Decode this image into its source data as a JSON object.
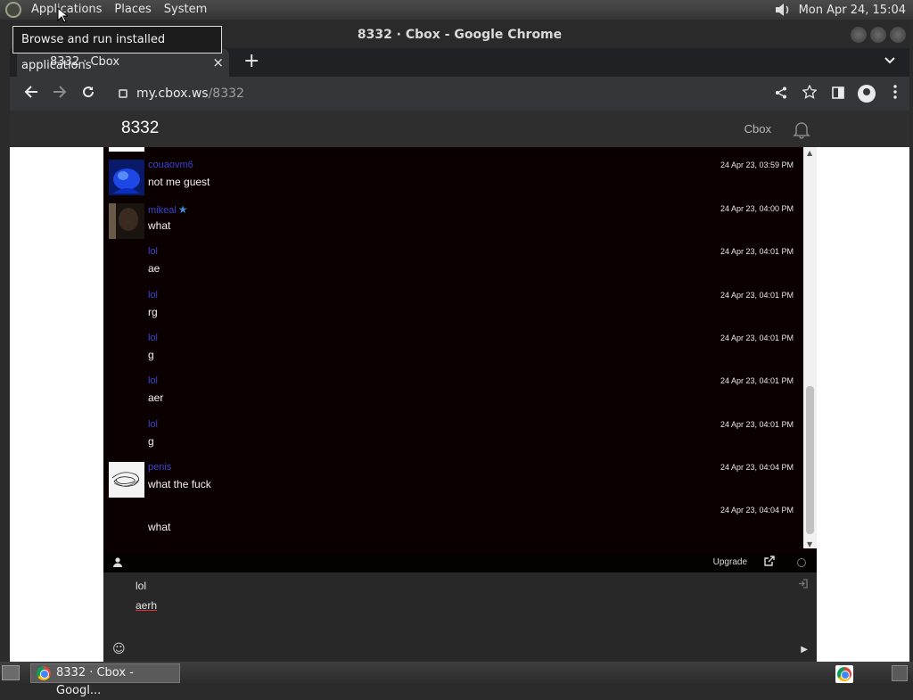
{
  "top_panel": {
    "menus": [
      "Applications",
      "Places",
      "System"
    ],
    "clock": "Mon Apr 24, 15:04"
  },
  "tooltip": "Browse and run installed applications",
  "window": {
    "title": "8332 · Cbox - Google Chrome"
  },
  "tab": {
    "title": "8332 · Cbox",
    "close": "×",
    "new_tab": "+"
  },
  "omnibox": {
    "host": "my.cbox.ws",
    "path": "/8332"
  },
  "site": {
    "title": "8332",
    "brand": "Cbox"
  },
  "messages": [
    {
      "name": "couaovm6",
      "text": "not me guest",
      "time": "24 Apr 23, 03:59 PM",
      "avatar": "blue-photo"
    },
    {
      "name": "mikeal",
      "text": "what",
      "time": "24 Apr 23, 04:00 PM",
      "avatar": "dark-photo",
      "starred": true
    },
    {
      "name": "lol",
      "text": "ae",
      "time": "24 Apr 23, 04:01 PM"
    },
    {
      "name": "lol",
      "text": "rg",
      "time": "24 Apr 23, 04:01 PM"
    },
    {
      "name": "lol",
      "text": "g",
      "time": "24 Apr 23, 04:01 PM"
    },
    {
      "name": "lol",
      "text": "aer",
      "time": "24 Apr 23, 04:01 PM"
    },
    {
      "name": "lol",
      "text": "g",
      "time": "24 Apr 23, 04:01 PM"
    },
    {
      "name": "penis",
      "text": "what the fuck",
      "time": "24 Apr 23, 04:04 PM",
      "avatar": "scribble"
    },
    {
      "name": "",
      "text": "what",
      "time": "24 Apr 23, 04:04 PM"
    }
  ],
  "chat_bar": {
    "upgrade": "Upgrade"
  },
  "compose": {
    "name_value": "lol",
    "message_value": "aerh"
  },
  "taskbar": {
    "task_label": "8332 · Cbox - Googl..."
  },
  "colors": {
    "chat_bg": "#0a0000",
    "username": "#3c42d4",
    "star": "#3b8bd8"
  }
}
